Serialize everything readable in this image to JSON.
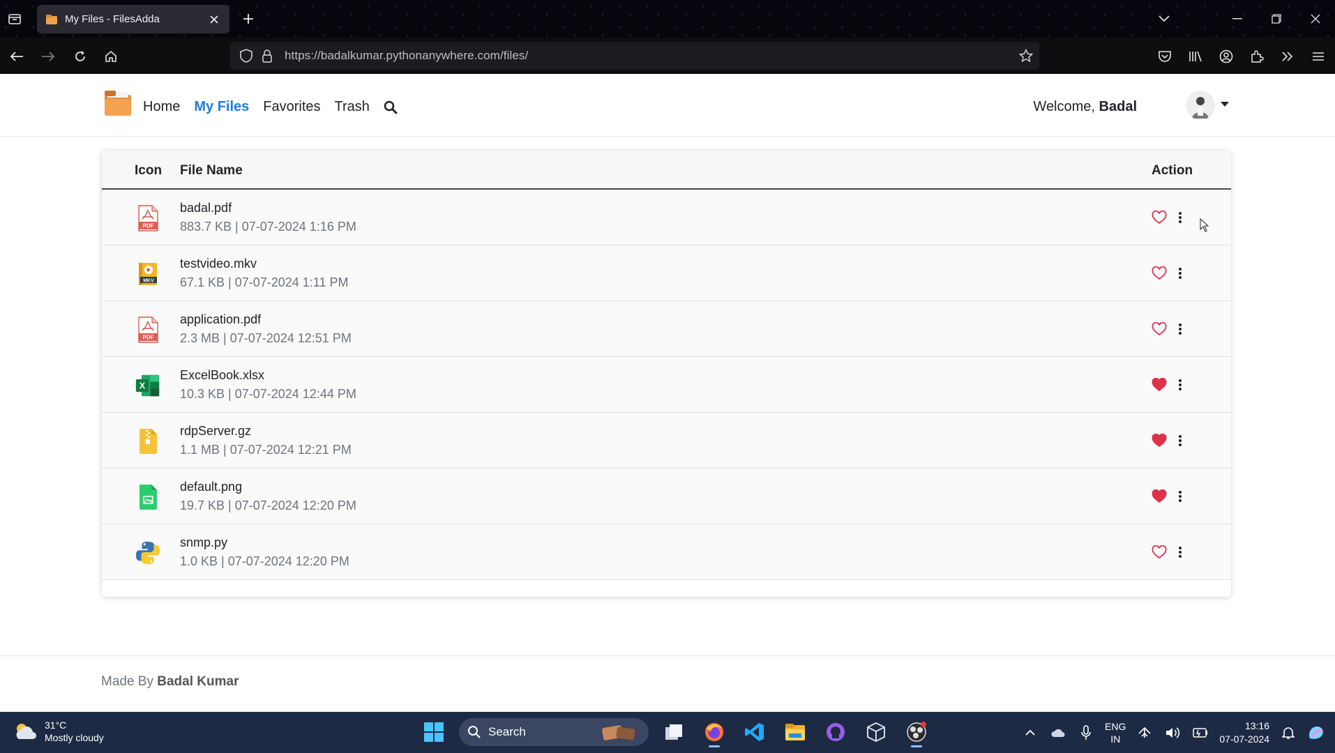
{
  "browser": {
    "tab_title": "My Files - FilesAdda",
    "url_host": "https://badalkumar.pythonanywhere.com",
    "url_path": "/files/"
  },
  "nav": {
    "home": "Home",
    "my_files": "My Files",
    "favorites": "Favorites",
    "trash": "Trash",
    "welcome_prefix": "Welcome,",
    "username": "Badal"
  },
  "table": {
    "col_icon": "Icon",
    "col_name": "File Name",
    "col_action": "Action",
    "rows": [
      {
        "name": "badal.pdf",
        "meta": "883.7 KB | 07-07-2024 1:16 PM",
        "type": "pdf",
        "favorite": false
      },
      {
        "name": "testvideo.mkv",
        "meta": "67.1 KB | 07-07-2024 1:11 PM",
        "type": "mkv",
        "favorite": false
      },
      {
        "name": "application.pdf",
        "meta": "2.3 MB | 07-07-2024 12:51 PM",
        "type": "pdf",
        "favorite": false
      },
      {
        "name": "ExcelBook.xlsx",
        "meta": "10.3 KB | 07-07-2024 12:44 PM",
        "type": "xlsx",
        "favorite": true
      },
      {
        "name": "rdpServer.gz",
        "meta": "1.1 MB | 07-07-2024 12:21 PM",
        "type": "zip",
        "favorite": true
      },
      {
        "name": "default.png",
        "meta": "19.7 KB | 07-07-2024 12:20 PM",
        "type": "image",
        "favorite": true
      },
      {
        "name": "snmp.py",
        "meta": "1.0 KB | 07-07-2024 12:20 PM",
        "type": "python",
        "favorite": false
      }
    ]
  },
  "footer": {
    "prefix": "Made By",
    "author": "Badal Kumar"
  },
  "taskbar": {
    "temperature": "31°C",
    "weather": "Mostly cloudy",
    "search": "Search",
    "lang_1": "ENG",
    "lang_2": "IN",
    "time": "13:16",
    "date": "07-07-2024"
  },
  "colors": {
    "accent": "#1c7ce6",
    "heart": "#e0314b"
  }
}
